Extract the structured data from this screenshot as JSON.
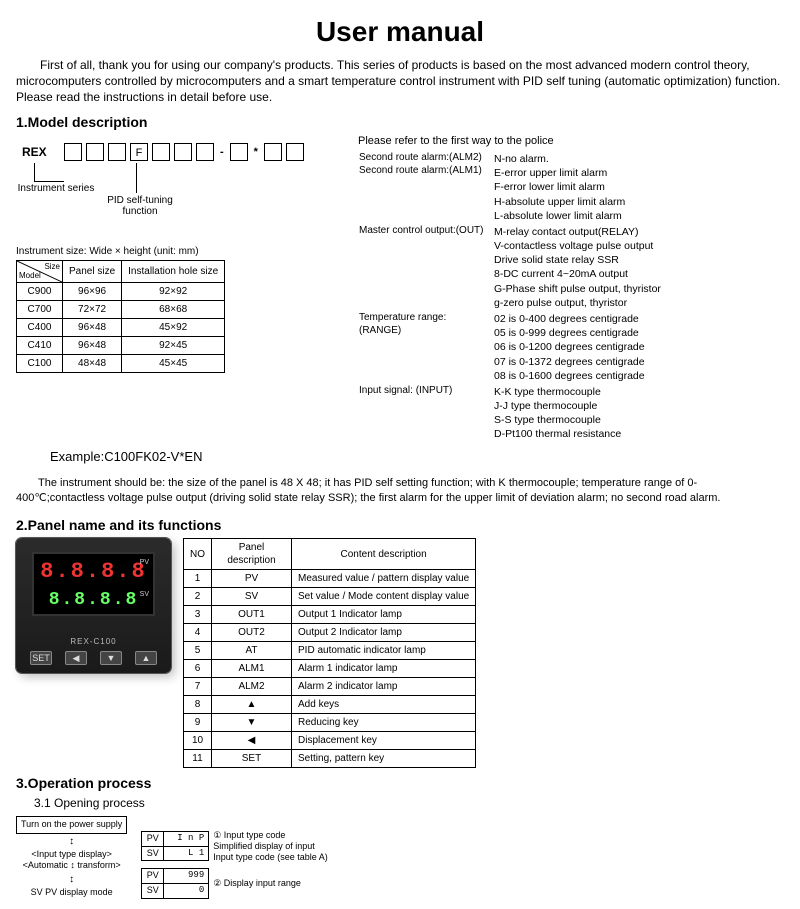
{
  "title": "User manual",
  "intro": "First of all, thank you for using our company's products. This series of products is based on the most advanced modern control theory, microcomputers controlled by microcomputers and a smart temperature control instrument with PID self tuning (automatic optimization) function. Please read the instructions in detail before use.",
  "s1": {
    "heading": "1.Model description",
    "series": "REX",
    "fbox": "F",
    "sep": "*",
    "lbl_series": "Instrument series",
    "lbl_pid": "PID self-tuning function",
    "size_caption": "Instrument size: Wide × height (unit: mm)",
    "size_headers": [
      "Model",
      "Panel size",
      "Installation hole size"
    ],
    "size_rows": [
      [
        "C900",
        "96×96",
        "92×92"
      ],
      [
        "C700",
        "72×72",
        "68×68"
      ],
      [
        "C400",
        "96×48",
        "45×92"
      ],
      [
        "C410",
        "96×48",
        "92×45"
      ],
      [
        "C100",
        "48×48",
        "45×45"
      ]
    ],
    "size_corner": "Size",
    "right_top": "Please refer to the first way to the police",
    "defs": [
      {
        "left": "Second route alarm:(ALM2)\nSecond route alarm:(ALM1)",
        "right": "N-no alarm.\nE-error upper limit alarm\nF-error lower limit alarm\nH-absolute upper limit alarm\nL-absolute lower limit alarm"
      },
      {
        "left": "Master control output:(OUT)",
        "right": "M-relay contact output(RELAY)\nV-contactless voltage pulse output\n   Drive solid state relay SSR\n8-DC current 4~20mA output\nG-Phase shift pulse output, thyristor\ng-zero pulse output, thyristor"
      },
      {
        "left": "Temperature range:(RANGE)",
        "right": "02 is 0-400 degrees centigrade\n05 is 0-999 degrees centigrade\n06 is 0-1200 degrees centigrade\n07 is 0-1372 degrees centigrade\n08 is 0-1600 degrees centigrade"
      },
      {
        "left": "Input signal: (INPUT)",
        "right": "K-K type thermocouple\nJ-J type thermocouple\nS-S type thermocouple\nD-Pt100 thermal resistance"
      }
    ],
    "example_label": "Example:C100FK02-V*EN",
    "instr_p": "The instrument should be: the size of the panel is 48 X 48; it has PID self setting function; with K thermocouple; temperature range of 0-400℃;contactless voltage pulse output (driving solid state relay SSR); the first alarm for the upper limit of deviation alarm; no second road alarm."
  },
  "s2": {
    "heading": "2.Panel name and its functions",
    "device": {
      "pv": "8.8.8.8",
      "sv": "8.8.8.8",
      "model": "REX-C100",
      "pv_lbl": "PV",
      "sv_lbl": "SV"
    },
    "buttons": [
      "SET",
      "◀",
      "▼",
      "▲"
    ],
    "table_headers": [
      "NO",
      "Panel description",
      "Content description"
    ],
    "rows": [
      [
        "1",
        "PV",
        "Measured value / pattern display value"
      ],
      [
        "2",
        "SV",
        "Set value / Mode content display value"
      ],
      [
        "3",
        "OUT1",
        "Output 1 Indicator lamp"
      ],
      [
        "4",
        "OUT2",
        "Output 2 Indicator lamp"
      ],
      [
        "5",
        "AT",
        "PID automatic indicator lamp"
      ],
      [
        "6",
        "ALM1",
        "Alarm 1 indicator lamp"
      ],
      [
        "7",
        "ALM2",
        "Alarm 2 indicator lamp"
      ],
      [
        "8",
        "▲",
        "Add keys"
      ],
      [
        "9",
        "▼",
        "Reducing key"
      ],
      [
        "10",
        "◀",
        "Displacement key"
      ],
      [
        "11",
        "SET",
        "Setting, pattern key"
      ]
    ]
  },
  "s3": {
    "heading": "3.Operation process",
    "sub": "3.1 Opening process",
    "power": "Turn on the power supply",
    "step1_top": "Input type display",
    "step1_bot": "Automatic ↕ transform",
    "disp1_pv": "I n P",
    "disp1_sv": "L 1",
    "disp2_pv": "999",
    "disp2_sv": "0",
    "note1_a": "① Input type code",
    "note1_b": "Simplified display of input",
    "note1_c": "Input type code (see table A)",
    "note2": "② Display input range",
    "footer": "SV PV display mode"
  }
}
